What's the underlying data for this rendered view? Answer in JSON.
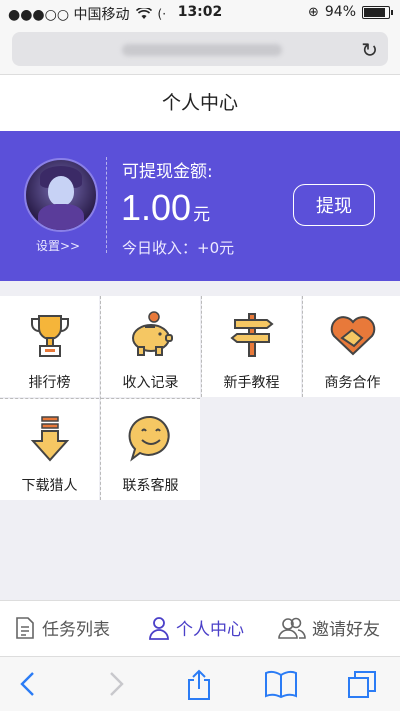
{
  "status_bar": {
    "carrier": "●●●○○ 中国移动",
    "time": "13:02",
    "battery": "94%",
    "battery_level": 0.94
  },
  "browser": {
    "reload_icon": "reload-icon"
  },
  "page": {
    "title": "个人中心"
  },
  "account": {
    "settings_link": "设置>>",
    "cash_title": "可提现金额:",
    "cash_amount": "1.00",
    "cash_unit": "元",
    "today_income": "今日收入：+0元",
    "withdraw_label": "提现",
    "accent_color": "#5b50d9"
  },
  "grid": {
    "items": [
      {
        "label": "排行榜",
        "icon": "trophy-icon"
      },
      {
        "label": "收入记录",
        "icon": "piggy-bank-icon"
      },
      {
        "label": "新手教程",
        "icon": "signpost-icon"
      },
      {
        "label": "商务合作",
        "icon": "handshake-icon"
      },
      {
        "label": "下载猎人",
        "icon": "download-arrow-icon"
      },
      {
        "label": "联系客服",
        "icon": "smile-chat-icon"
      }
    ]
  },
  "tabs": [
    {
      "label": "任务列表",
      "icon": "document-icon",
      "active": false
    },
    {
      "label": "个人中心",
      "icon": "person-icon",
      "active": true
    },
    {
      "label": "邀请好友",
      "icon": "friends-icon",
      "active": false
    }
  ]
}
